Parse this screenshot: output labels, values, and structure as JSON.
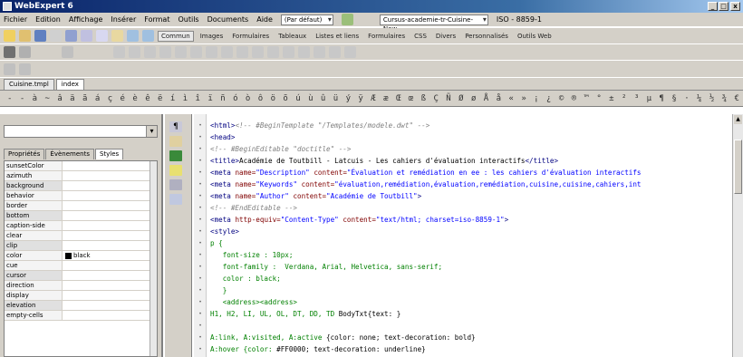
{
  "window": {
    "title": "WebExpert 6",
    "minimize": "_",
    "maximize": "□",
    "close": "x"
  },
  "menu": {
    "items": [
      "Fichier",
      "Edition",
      "Affichage",
      "Insérer",
      "Format",
      "Outils",
      "Documents",
      "Aide"
    ],
    "style_combo": "(Par défaut)",
    "doc_combo": "Cursus-academie-tr-Cuisine-New",
    "encoding": "ISO - 8859-1"
  },
  "toolbar2": {
    "tabs": [
      "Commun",
      "Images",
      "Formulaires",
      "Tableaux",
      "Listes et liens",
      "Formulaires",
      "CSS",
      "Divers",
      "Personnalisés",
      "Outils Web"
    ]
  },
  "doc_tabs": [
    "Cuisine.tmpl",
    "index"
  ],
  "left_panel": {
    "ptabs": [
      "Propriétés",
      "Évènements",
      "Styles"
    ],
    "rows": [
      {
        "name": "sunsetColor",
        "value": ""
      },
      {
        "name": "azimuth",
        "value": ""
      },
      {
        "name": "background",
        "value": ""
      },
      {
        "name": "behavior",
        "value": ""
      },
      {
        "name": "border",
        "value": ""
      },
      {
        "name": "bottom",
        "value": ""
      },
      {
        "name": "caption-side",
        "value": ""
      },
      {
        "name": "clear",
        "value": ""
      },
      {
        "name": "clip",
        "value": ""
      },
      {
        "name": "color",
        "value": "black"
      },
      {
        "name": "cue",
        "value": ""
      },
      {
        "name": "cursor",
        "value": ""
      },
      {
        "name": "direction",
        "value": ""
      },
      {
        "name": "display",
        "value": ""
      },
      {
        "name": "elevation",
        "value": ""
      },
      {
        "name": "empty-cells",
        "value": ""
      }
    ]
  },
  "editor": {
    "lines": [
      {
        "parts": [
          [
            "tag",
            "<html>"
          ],
          [
            "com",
            "<!-- #BeginTemplate \"/Templates/modele.dwt\" -->"
          ]
        ]
      },
      {
        "parts": [
          [
            "tag",
            "<head>"
          ]
        ]
      },
      {
        "parts": [
          [
            "com",
            "<!-- #BeginEditable \"doctitle\" -->"
          ]
        ]
      },
      {
        "parts": [
          [
            "tag",
            "<title>"
          ],
          [
            "",
            "Académie de Toutbill - Latcuis - Les cahiers d'évaluation interactifs"
          ],
          [
            "tag",
            "</title>"
          ]
        ]
      },
      {
        "parts": [
          [
            "tag",
            "<meta "
          ],
          [
            "attr",
            "name="
          ],
          [
            "str",
            "\"Description\" "
          ],
          [
            "attr",
            "content="
          ],
          [
            "str",
            "\"Évaluation et remédiation en ee : les cahiers d'évaluation interactifs"
          ]
        ]
      },
      {
        "parts": [
          [
            "tag",
            "<meta "
          ],
          [
            "attr",
            "name="
          ],
          [
            "str",
            "\"Keywords\" "
          ],
          [
            "attr",
            "content="
          ],
          [
            "str",
            "\"évaluation,remédiation,évaluation,remédiation,cuisine,cuisine,cahiers,int"
          ]
        ]
      },
      {
        "parts": [
          [
            "tag",
            "<meta "
          ],
          [
            "attr",
            "name="
          ],
          [
            "str",
            "\"Author\" "
          ],
          [
            "attr",
            "content="
          ],
          [
            "str",
            "\"Académie de Toutbill\""
          ],
          [
            "tag",
            ">"
          ]
        ]
      },
      {
        "parts": [
          [
            "com",
            "<!-- #EndEditable -->"
          ]
        ]
      },
      {
        "parts": [
          [
            "tag",
            "<meta "
          ],
          [
            "attr",
            "http-equiv="
          ],
          [
            "str",
            "\"Content-Type\" "
          ],
          [
            "attr",
            "content="
          ],
          [
            "str",
            "\"text/html; charset=iso-8859-1\""
          ],
          [
            "tag",
            ">"
          ]
        ]
      },
      {
        "parts": [
          [
            "tag",
            "<style>"
          ]
        ]
      },
      {
        "parts": [
          [
            "css",
            "p {"
          ]
        ]
      },
      {
        "parts": [
          [
            "css",
            "   font-size : 10px;"
          ]
        ]
      },
      {
        "parts": [
          [
            "css",
            "   font-family :  Verdana, Arial, Helvetica, sans-serif;"
          ]
        ]
      },
      {
        "parts": [
          [
            "css",
            "   color : black;"
          ]
        ]
      },
      {
        "parts": [
          [
            "css",
            "   }"
          ]
        ]
      },
      {
        "parts": [
          [
            "css",
            "   <address><address>"
          ]
        ]
      },
      {
        "parts": [
          [
            "css",
            "H1, H2, LI, UL, OL, DT, DD, TD "
          ],
          [
            "",
            "BodyTxt{text: }"
          ]
        ]
      },
      {
        "parts": [
          [
            "",
            ""
          ]
        ]
      },
      {
        "parts": [
          [
            "css",
            "A:link, A:visited, A:active "
          ],
          [
            "",
            "{color: none; text-decoration: bold}"
          ]
        ]
      },
      {
        "parts": [
          [
            "css",
            "A:hover {color: "
          ],
          [
            "",
            "#FF0000; text-decoration: underline}"
          ]
        ]
      }
    ]
  }
}
